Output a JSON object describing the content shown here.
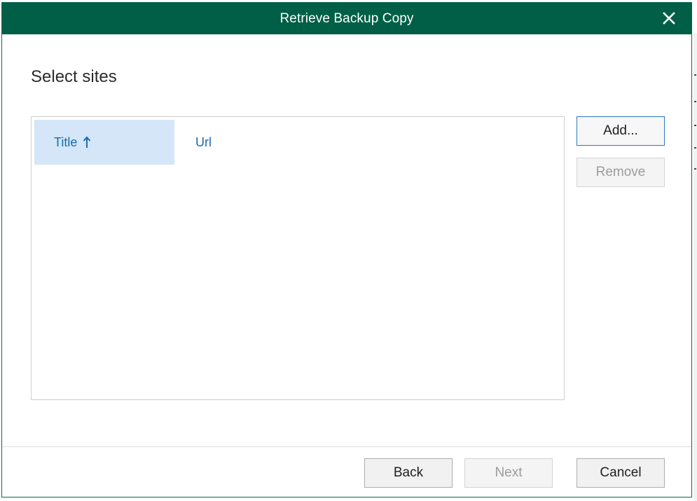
{
  "dialog": {
    "title": "Retrieve Backup Copy",
    "close_icon": "close-icon"
  },
  "step": {
    "heading": "Select sites"
  },
  "sites_list": {
    "columns": [
      {
        "label": "Title",
        "sorted": "ascending",
        "sort_icon": "arrow-up-icon"
      },
      {
        "label": "Url"
      }
    ],
    "rows": []
  },
  "side_buttons": {
    "add_label": "Add...",
    "remove_label": "Remove"
  },
  "footer": {
    "back_label": "Back",
    "next_label": "Next",
    "cancel_label": "Cancel"
  },
  "colors": {
    "titlebar": "#005f46",
    "header_selected": "#d4e6f7",
    "link_text": "#1a6bb0"
  }
}
